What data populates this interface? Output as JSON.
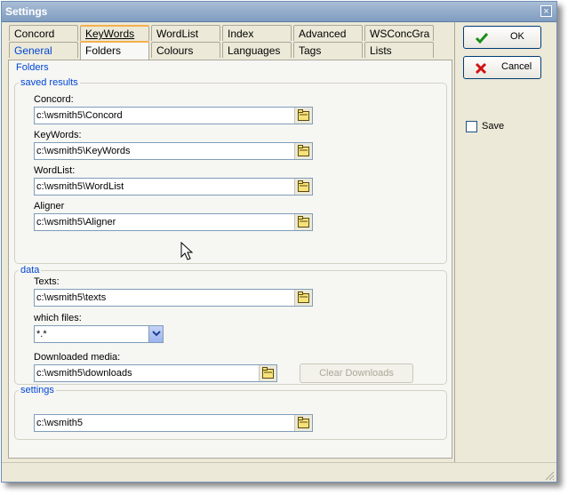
{
  "window": {
    "title": "Settings",
    "close_glyph": "×"
  },
  "tabs_row1": [
    {
      "label": "Concord"
    },
    {
      "label": "KeyWords"
    },
    {
      "label": "WordList"
    },
    {
      "label": "Index"
    },
    {
      "label": "Advanced"
    },
    {
      "label": "WSConcGra"
    }
  ],
  "tabs_row2": [
    {
      "label": "General"
    },
    {
      "label": "Folders"
    },
    {
      "label": "Colours"
    },
    {
      "label": "Languages"
    },
    {
      "label": "Tags"
    },
    {
      "label": "Lists"
    }
  ],
  "active_tab": "Folders",
  "folders": {
    "title": "Folders",
    "saved_results": {
      "legend": "saved results",
      "concord": {
        "label": "Concord:",
        "value": "c:\\wsmith5\\Concord"
      },
      "keywords": {
        "label": "KeyWords:",
        "value": "c:\\wsmith5\\KeyWords"
      },
      "wordlist": {
        "label": "WordList:",
        "value": "c:\\wsmith5\\WordList"
      },
      "aligner": {
        "label": "Aligner",
        "value": "c:\\wsmith5\\Aligner"
      }
    },
    "data": {
      "legend": "data",
      "texts": {
        "label": "Texts:",
        "value": "c:\\wsmith5\\texts"
      },
      "which_files": {
        "label": "which files:",
        "value": "*.*"
      },
      "downloaded_media": {
        "label": "Downloaded media:",
        "value": "c:\\wsmith5\\downloads"
      },
      "clear_downloads_label": "Clear Downloads"
    },
    "settings": {
      "legend": "settings",
      "value": "c:\\wsmith5"
    }
  },
  "actions": {
    "ok_label": "OK",
    "cancel_label": "Cancel",
    "save_label": "Save",
    "save_checked": false
  },
  "icons": {
    "folder": "folder-icon",
    "ok": "checkmark-icon",
    "cancel": "red-x-icon",
    "dropdown": "chevron-down-icon"
  },
  "colors": {
    "legend_text": "#0046d5",
    "ok_check": "#1a8c1a",
    "cancel_x": "#d41010",
    "tab_highlight": "#f4b04c"
  }
}
